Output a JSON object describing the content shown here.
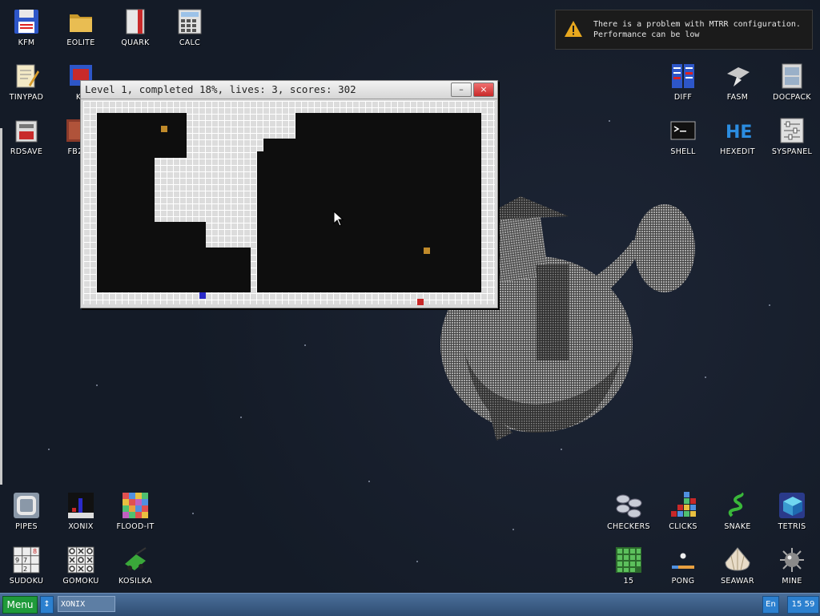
{
  "desktop": {
    "icons": [
      {
        "id": "kfm",
        "label": "KFM",
        "icon": "floppy-icon"
      },
      {
        "id": "eolite",
        "label": "EOLITE",
        "icon": "folder-icon"
      },
      {
        "id": "quark",
        "label": "QUARK",
        "icon": "notebook-icon"
      },
      {
        "id": "calc",
        "label": "CALC",
        "icon": "calculator-icon"
      },
      {
        "id": "tinypad",
        "label": "TINYPAD",
        "icon": "notepad-icon"
      },
      {
        "id": "kf",
        "label": "KF",
        "icon": "editor-icon"
      },
      {
        "id": "rdsave",
        "label": "RDSAVE",
        "icon": "disk-save-icon"
      },
      {
        "id": "fb2",
        "label": "FB2",
        "icon": "book-icon"
      },
      {
        "id": "diff",
        "label": "DIFF",
        "icon": "diff-icon"
      },
      {
        "id": "fasm",
        "label": "FASM",
        "icon": "bolt-icon"
      },
      {
        "id": "docpack",
        "label": "DOCPACK",
        "icon": "cabinet-icon"
      },
      {
        "id": "shell",
        "label": "SHELL",
        "icon": "terminal-icon"
      },
      {
        "id": "hexedit",
        "label": "HEXEDIT",
        "icon": "hex-icon"
      },
      {
        "id": "syspanel",
        "label": "SYSPANEL",
        "icon": "sliders-icon"
      },
      {
        "id": "pipes",
        "label": "PIPES",
        "icon": "pipes-icon"
      },
      {
        "id": "xonix",
        "label": "XONIX",
        "icon": "xonix-icon"
      },
      {
        "id": "floodit",
        "label": "FLOOD-IT",
        "icon": "flood-icon"
      },
      {
        "id": "sudoku",
        "label": "SUDOKU",
        "icon": "sudoku-icon"
      },
      {
        "id": "gomoku",
        "label": "GOMOKU",
        "icon": "gomoku-icon"
      },
      {
        "id": "kosilka",
        "label": "KOSILKA",
        "icon": "mower-icon"
      },
      {
        "id": "checkers",
        "label": "CHECKERS",
        "icon": "checkers-icon"
      },
      {
        "id": "clicks",
        "label": "CLICKS",
        "icon": "blocks-icon"
      },
      {
        "id": "snake",
        "label": "SNAKE",
        "icon": "snake-icon"
      },
      {
        "id": "tetris",
        "label": "TETRIS",
        "icon": "tetris-icon"
      },
      {
        "id": "fifteen",
        "label": "15",
        "icon": "fifteen-icon"
      },
      {
        "id": "pong",
        "label": "PONG",
        "icon": "pong-icon"
      },
      {
        "id": "seawar",
        "label": "SEAWAR",
        "icon": "shell-sea-icon"
      },
      {
        "id": "mine",
        "label": "MINE",
        "icon": "mine-icon"
      }
    ]
  },
  "notification": {
    "line1": "There is a problem with MTRR configuration.",
    "line2": "Performance can be low"
  },
  "game_window": {
    "title": "Level 1, completed 18%, lives: 3, scores: 302",
    "minimize_label": "–",
    "close_label": "×"
  },
  "taskbar": {
    "menu_label": "Menu",
    "switch_label": "↕",
    "task_label": "XONIX",
    "lang_label": "En",
    "clock": "15 59"
  },
  "colors": {
    "enemy_ball": "#c08a2a",
    "player": "#2a2ac8",
    "land_enemy": "#c82828"
  }
}
